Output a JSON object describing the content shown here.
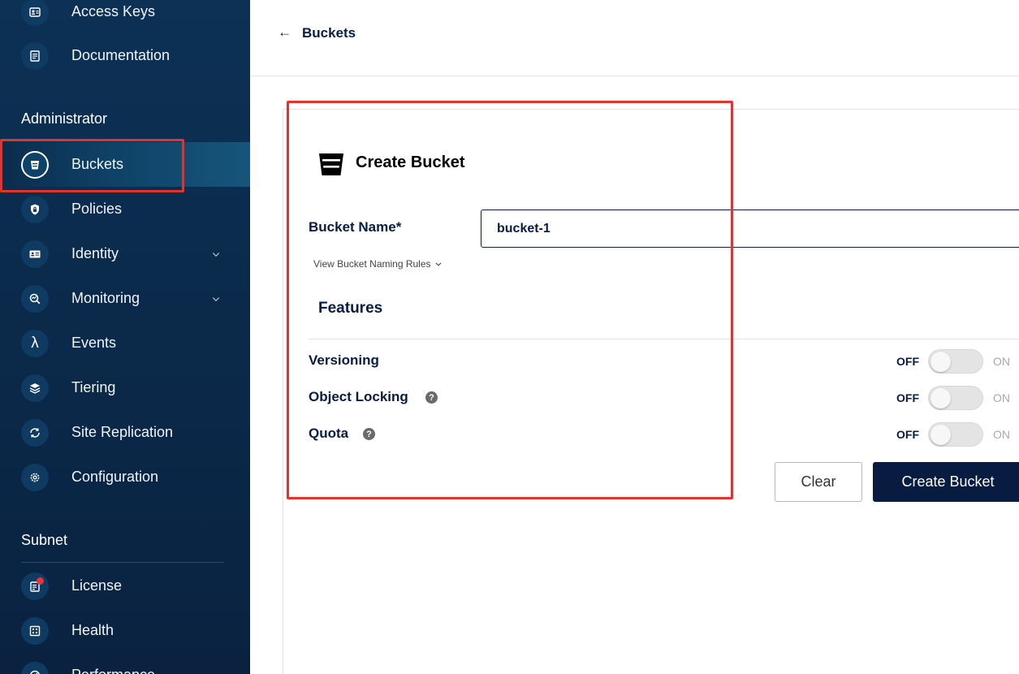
{
  "sidebar": {
    "top_items": [
      {
        "label": "Access Keys",
        "icon": "access-keys-icon"
      },
      {
        "label": "Documentation",
        "icon": "documentation-icon"
      }
    ],
    "admin_section_title": "Administrator",
    "admin_items": [
      {
        "label": "Buckets",
        "icon": "bucket-icon",
        "active": true
      },
      {
        "label": "Policies",
        "icon": "shield-lock-icon"
      },
      {
        "label": "Identity",
        "icon": "id-card-icon",
        "expandable": true
      },
      {
        "label": "Monitoring",
        "icon": "magnifier-chart-icon",
        "expandable": true
      },
      {
        "label": "Events",
        "icon": "lambda-icon",
        "glyph": "λ"
      },
      {
        "label": "Tiering",
        "icon": "layers-icon"
      },
      {
        "label": "Site Replication",
        "icon": "sync-icon"
      },
      {
        "label": "Configuration",
        "icon": "gear-icon"
      }
    ],
    "subnet_section_title": "Subnet",
    "subnet_items": [
      {
        "label": "License",
        "icon": "license-icon",
        "has_notification_dot": true
      },
      {
        "label": "Health",
        "icon": "health-icon"
      },
      {
        "label": "Performance",
        "icon": "performance-icon"
      }
    ]
  },
  "header": {
    "back_glyph": "←",
    "breadcrumb": "Buckets"
  },
  "form": {
    "title": "Create Bucket",
    "bucket_name_label": "Bucket Name*",
    "bucket_name_value": "bucket-1",
    "naming_rules_link": "View Bucket Naming Rules",
    "features_title": "Features",
    "features": [
      {
        "label": "Versioning",
        "off": "OFF",
        "on": "ON",
        "state": "off",
        "has_help": false
      },
      {
        "label": "Object Locking",
        "off": "OFF",
        "on": "ON",
        "state": "off",
        "has_help": true
      },
      {
        "label": "Quota",
        "off": "OFF",
        "on": "ON",
        "state": "off",
        "has_help": true
      }
    ],
    "help_glyph": "?",
    "clear_label": "Clear",
    "create_label": "Create Bucket"
  },
  "colors": {
    "sidebar_bg": "#0b2b4c",
    "primary": "#081c42",
    "highlight": "#e2332f"
  }
}
